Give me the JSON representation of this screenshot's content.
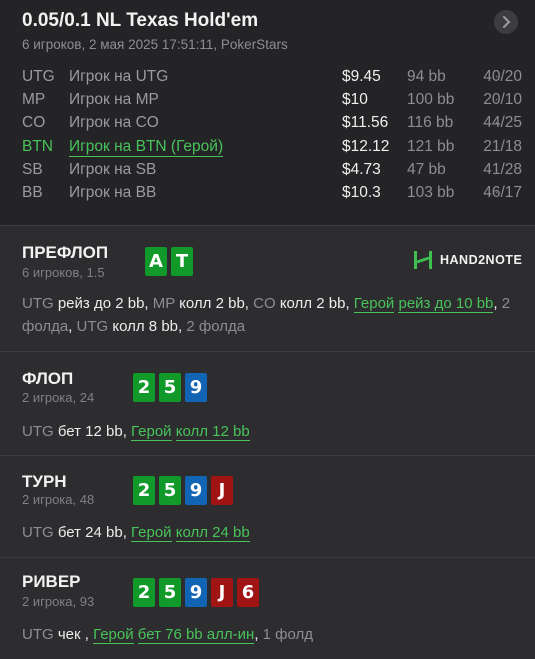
{
  "hand": {
    "title": "0.05/0.1 NL Texas Hold'em",
    "subtitle": "6 игроков, 2 мая 2025 17:51:11, PokerStars"
  },
  "players": [
    {
      "pos": "UTG",
      "name": "Игрок на UTG",
      "stack": "$9.45",
      "bb": "94 bb",
      "dot": "·",
      "stat": "40/20"
    },
    {
      "pos": "MP",
      "name": "Игрок на MP",
      "stack": "$10",
      "bb": "100 bb",
      "dot": "·",
      "stat": "20/10"
    },
    {
      "pos": "CO",
      "name": "Игрок на CO",
      "stack": "$11.56",
      "bb": "116 bb",
      "dot": "·",
      "stat": "44/25"
    },
    {
      "pos": "BTN",
      "name": "Игрок на BTN (Герой)",
      "stack": "$12.12",
      "bb": "121 bb",
      "dot": "·",
      "stat": "21/18"
    },
    {
      "pos": "SB",
      "name": "Игрок на SB",
      "stack": "$4.73",
      "bb": "47 bb",
      "dot": "·",
      "stat": "41/28"
    },
    {
      "pos": "BB",
      "name": "Игрок на BB",
      "stack": "$10.3",
      "bb": "103 bb",
      "dot": "·",
      "stat": "46/17"
    }
  ],
  "logo": {
    "text": "HAND2NOTE"
  },
  "streets": {
    "preflop": {
      "name": "ПРЕФЛОП",
      "info": "6 игроков, 1.5",
      "cards": [
        {
          "rank": "A",
          "color": "#119a2a"
        },
        {
          "rank": "T",
          "color": "#119a2a"
        }
      ],
      "actions": [
        {
          "player": "UTG",
          "action": "рейз до 2 bb",
          "sep": ","
        },
        {
          "player": "MP",
          "action": "колл 2 bb",
          "sep": ","
        },
        {
          "player": "CO",
          "action": "колл 2 bb",
          "sep": ","
        },
        {
          "player": "Герой",
          "action": "рейз до 10 bb",
          "sep": ","
        },
        {
          "player": "2 фолда",
          "action": "",
          "sep": ","
        },
        {
          "player": "UTG",
          "action": "колл 8 bb",
          "sep": ","
        },
        {
          "player": "2 фолда",
          "action": "",
          "sep": ""
        }
      ]
    },
    "flop": {
      "name": "ФЛОП",
      "info": "2 игрока, 24",
      "cards": [
        {
          "rank": "2",
          "color": "#119a2a"
        },
        {
          "rank": "5",
          "color": "#119a2a"
        },
        {
          "rank": "9",
          "color": "#1264b4"
        }
      ],
      "actions": [
        {
          "player": "UTG",
          "action": "бет 12 bb",
          "sep": ","
        },
        {
          "player": "Герой",
          "action": "колл 12 bb",
          "sep": ""
        }
      ]
    },
    "turn": {
      "name": "ТУРН",
      "info": "2 игрока, 48",
      "cards": [
        {
          "rank": "2",
          "color": "#119a2a"
        },
        {
          "rank": "5",
          "color": "#119a2a"
        },
        {
          "rank": "9",
          "color": "#1264b4"
        },
        {
          "rank": "J",
          "color": "#a11414"
        }
      ],
      "actions": [
        {
          "player": "UTG",
          "action": "бет 24 bb",
          "sep": ","
        },
        {
          "player": "Герой",
          "action": "колл 24 bb",
          "sep": ""
        }
      ]
    },
    "river": {
      "name": "РИВЕР",
      "info": "2 игрока, 93",
      "cards": [
        {
          "rank": "2",
          "color": "#119a2a"
        },
        {
          "rank": "5",
          "color": "#119a2a"
        },
        {
          "rank": "9",
          "color": "#1264b4"
        },
        {
          "rank": "J",
          "color": "#a11414"
        },
        {
          "rank": "6",
          "color": "#a11414"
        }
      ],
      "actions": [
        {
          "player": "UTG",
          "action": "чек",
          "sep": " ,"
        },
        {
          "player": "Герой",
          "action": "бет 76 bb алл-ин",
          "sep": ","
        },
        {
          "player": "1 фолд",
          "action": "",
          "sep": ""
        }
      ]
    }
  }
}
